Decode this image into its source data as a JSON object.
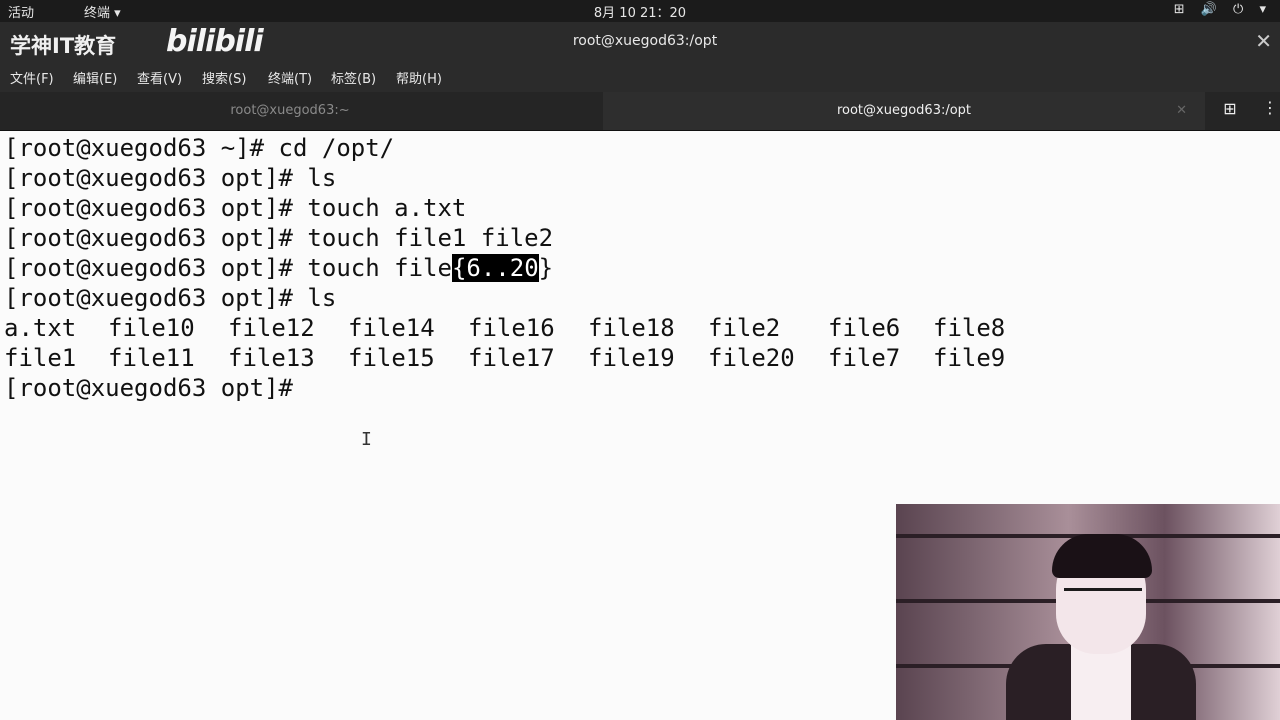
{
  "topbar": {
    "activities": "活动",
    "app_menu": "终端 ▾",
    "clock": "8月 10  21：20",
    "tray": "⊞ 🔊 ⏻ ▾"
  },
  "window": {
    "logo_text": "学神IT教育",
    "watermark": "bilibili",
    "title": "root@xuegod63:/opt"
  },
  "menu": {
    "file": "文件(F)",
    "edit": "编辑(E)",
    "view": "查看(V)",
    "search": "搜索(S)",
    "terminal": "终端(T)",
    "tabs": "标签(B)",
    "help": "帮助(H)"
  },
  "tabs": [
    {
      "label": "root@xuegod63:~",
      "active": false
    },
    {
      "label": "root@xuegod63:/opt",
      "active": true
    }
  ],
  "terminal": {
    "lines": [
      "[root@xuegod63 ~]# cd /opt/",
      "[root@xuegod63 opt]# ls",
      "[root@xuegod63 opt]# touch a.txt",
      "[root@xuegod63 opt]# touch file1 file2"
    ],
    "line5_prefix": "[root@xuegod63 opt]# touch file",
    "line5_brace_open": "{",
    "line5_selected": "6..20",
    "line5_brace_close": "}",
    "line6": "[root@xuegod63 opt]# ls",
    "ls_row1": [
      "a.txt",
      "file10",
      "file12",
      "file14",
      "file16",
      "file18",
      "file2",
      "file6",
      "file8"
    ],
    "ls_row2": [
      "file1",
      "file11",
      "file13",
      "file15",
      "file17",
      "file19",
      "file20",
      "file7",
      "file9"
    ],
    "prompt": "[root@xuegod63 opt]#"
  }
}
